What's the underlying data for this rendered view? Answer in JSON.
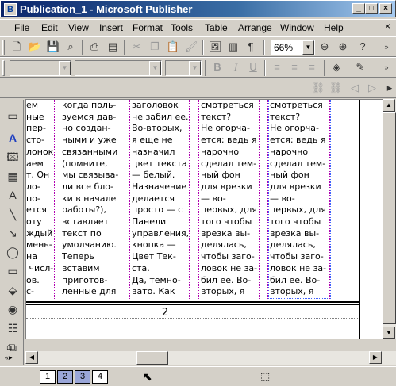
{
  "window": {
    "title": "Publication_1 - Microsoft Publisher",
    "app_icon_letter": "B",
    "minimize": "_",
    "maximize": "□",
    "close": "×"
  },
  "menu": [
    "File",
    "Edit",
    "View",
    "Insert",
    "Format",
    "Tools",
    "Table",
    "Arrange",
    "Window",
    "Help"
  ],
  "standard_toolbar": {
    "zoom_value": "66%"
  },
  "format_toolbar": {
    "bold": "B",
    "italic": "I",
    "underline": "U"
  },
  "columns": [
    "ем\nные\nпер-\nсто-\nлонок\nаем\nт. Он\nло-\nпо-\nется\nоту\nждый\nмень-\nна\n числ-\nов.\nс-\nто",
    "когда поль-\nзуемся дав-\nно создан-\nными и уже\nсвязанными\n(помните,\nмы связыва-\nли все бло-\nки в начале\nработы?),\nвставляет\nтекст по\nумолчанию.\nТеперь\nвставим\nприготов-\nленные для\nстатьи ил-\nлюстрации.",
    "заголовок\nне забил ее.\nВо-вторых,\nя еще не\nназначил\nцвет текста\n— белый.\nНазначение\nделается\nпросто — с\nПанели\nуправления,\nкнопка —\nЦвет Тек-\nста.\nДа, темно-\nвато. Как\nже на таком\nфоне будет",
    "смотреться\nтекст?\nНе огорча-\nется: ведь я\nнарочно\nсделал тем-\nный фон\nдля врезки\n— во-\nпервых, для\nтого чтобы\nврезка вы-\nделялась,\nчтобы заго-\nловок не за-\nбил ее. Во-\nвторых, я\nеще не на-\nзначил цвет",
    "смотреться\nтекст?\nНе огорча-\nется: ведь я\nнарочно\nсделал тем-\nный фон\nдля врезки\n— во-\nпервых, для\nтого чтобы\nврезка вы-\nделялась,\nчтобы заго-\nловок не за-\nбил ее. Во-\nвторых, я\nеще не на-\nзначил цвет"
  ],
  "page_number": "2",
  "page_tabs": [
    "1",
    "2",
    "3",
    "4"
  ],
  "selected_page_tabs": [
    "2",
    "3"
  ]
}
